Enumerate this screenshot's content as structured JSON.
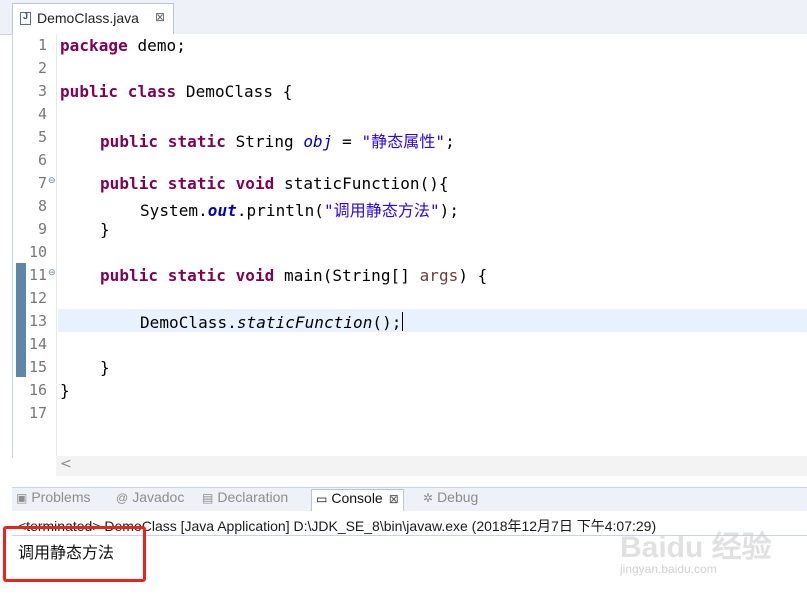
{
  "editor_tab": {
    "label": "DemoClass.java",
    "close": "⊠"
  },
  "line_numbers": [
    "1",
    "2",
    "3",
    "4",
    "5",
    "6",
    "7",
    "8",
    "9",
    "10",
    "11",
    "12",
    "13",
    "14",
    "15",
    "16",
    "17"
  ],
  "fold_marker": "⊖",
  "code": {
    "l1_kw": "package",
    "l1_rest": " demo;",
    "l3_kw1": "public",
    "l3_kw2": "class",
    "l3_rest": " DemoClass {",
    "l5_kw1": "public",
    "l5_kw2": "static",
    "l5_type": " String ",
    "l5_field": "obj",
    "l5_eq": " = ",
    "l5_str": "\"静态属性\"",
    "l5_end": ";",
    "l7_kw1": "public",
    "l7_kw2": "static",
    "l7_kw3": "void",
    "l7_rest": " staticFunction(){",
    "l8_a": "System.",
    "l8_field": "out",
    "l8_b": ".println(",
    "l8_str": "\"调用静态方法\"",
    "l8_end": ");",
    "l9": "}",
    "l11_kw1": "public",
    "l11_kw2": "static",
    "l11_kw3": "void",
    "l11_a": " main(String[] ",
    "l11_param": "args",
    "l11_b": ") {",
    "l13_a": "DemoClass.",
    "l13_method": "staticFunction",
    "l13_b": "();",
    "l15": "}",
    "l16": "}"
  },
  "panel_tabs": {
    "problems": "Problems",
    "javadoc": "Javadoc",
    "declaration": "Declaration",
    "console": "Console",
    "console_close": "⊠",
    "debug": "Debug"
  },
  "console": {
    "header": "<terminated> DemoClass [Java Application] D:\\JDK_SE_8\\bin\\javaw.exe (2018年12月7日 下午4:07:29)",
    "output": "调用静态方法"
  },
  "watermark": {
    "main": "Baidu 经验",
    "sub": "jingyan.baidu.com"
  },
  "colors": {
    "keyword": "#7f0055",
    "string": "#2a00ff",
    "field": "#0000c0",
    "highlight_box": "#e8241c"
  }
}
